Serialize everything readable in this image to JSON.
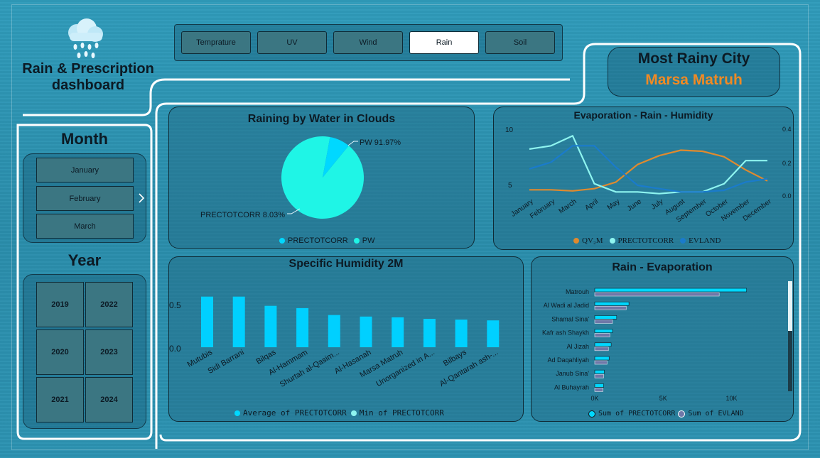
{
  "app": {
    "title_line1": "Rain & Prescription",
    "title_line2": "dashboard"
  },
  "tabs": [
    {
      "label": "Temprature",
      "active": false
    },
    {
      "label": "UV",
      "active": false
    },
    {
      "label": "Wind",
      "active": false
    },
    {
      "label": "Rain",
      "active": true
    },
    {
      "label": "Soil",
      "active": false
    }
  ],
  "kpi": {
    "title": "Most Rainy City",
    "value": "Marsa Matruh"
  },
  "month_slicer": {
    "title": "Month",
    "items": [
      "January",
      "February",
      "March"
    ]
  },
  "year_slicer": {
    "title": "Year",
    "items": [
      "2019",
      "2022",
      "2020",
      "2023",
      "2021",
      "2024"
    ]
  },
  "colors": {
    "accent_orange": "#f08a24",
    "cyan": "#00d8ff",
    "aqua": "#1ff5e6",
    "blue": "#1a7bcc",
    "light_cyan": "#8ff5f0",
    "violet": "#6f78a8"
  },
  "chart_data": [
    {
      "type": "pie",
      "title": "Raining by Water in Clouds",
      "slices": [
        {
          "name": "PW",
          "value": 91.97,
          "label": "PW 91.97%"
        },
        {
          "name": "PRECTOTCORR",
          "value": 8.03,
          "label": "PRECTOTCORR 8.03%"
        }
      ],
      "legend": [
        "PRECTOTCORR",
        "PW"
      ],
      "legend_position": "bottom"
    },
    {
      "type": "line",
      "title": "Evaporation - Rain - Humidity",
      "categories": [
        "January",
        "February",
        "March",
        "April",
        "May",
        "June",
        "July",
        "August",
        "September",
        "October",
        "November",
        "December"
      ],
      "y_left_ticks": [
        "10",
        "5"
      ],
      "y_right_ticks": [
        "0.4",
        "0.2",
        "0.0"
      ],
      "ylim_left": [
        4,
        10
      ],
      "ylim_right": [
        0,
        0.4
      ],
      "series": [
        {
          "name": "QV2M",
          "axis": "left",
          "values": [
            4.5,
            4.5,
            4.4,
            4.6,
            5.2,
            6.8,
            7.6,
            8.1,
            8.0,
            7.5,
            6.3,
            5.3
          ]
        },
        {
          "name": "PRECTOTCORR",
          "axis": "right",
          "values": [
            0.28,
            0.3,
            0.36,
            0.07,
            0.02,
            0.02,
            0.01,
            0.02,
            0.02,
            0.07,
            0.21,
            0.21
          ]
        },
        {
          "name": "EVLAND",
          "axis": "right",
          "values": [
            0.16,
            0.2,
            0.3,
            0.3,
            0.17,
            0.06,
            0.04,
            0.02,
            0.02,
            0.03,
            0.08,
            0.1
          ]
        }
      ],
      "legend": [
        "QV₂M",
        "PRECTOTCORR",
        "EVLAND"
      ],
      "legend_position": "bottom"
    },
    {
      "type": "bar",
      "title": "Specific Humidity 2M",
      "categories": [
        "Mutubis",
        "Sidi Barrani",
        "Bilqas",
        "Al-Hammam",
        "Shurtah al-Qasim...",
        "Al-Hasanah",
        "Marsa Matruh",
        "Unorganized in A...",
        "Bilbays",
        "Al-Qantarah ash-..."
      ],
      "series": [
        {
          "name": "Average of PRECTOTCORR",
          "values": [
            0.66,
            0.66,
            0.54,
            0.51,
            0.42,
            0.4,
            0.39,
            0.37,
            0.36,
            0.35
          ]
        },
        {
          "name": "Min of PRECTOTCORR",
          "values": [
            0,
            0,
            0,
            0,
            0,
            0,
            0,
            0,
            0,
            0
          ]
        }
      ],
      "y_ticks": [
        "0.5",
        "0.0"
      ],
      "ylim": [
        0,
        0.75
      ],
      "legend_position": "bottom"
    },
    {
      "type": "bar",
      "orientation": "horizontal",
      "title": "Rain - Evaporation",
      "categories": [
        "Matrouh",
        "Al Wadi al Jadid",
        "Shamal Sina'",
        "Kafr ash Shaykh",
        "Al Jizah",
        "Ad Daqahliyah",
        "Janub Sina'",
        "Al Buhayrah"
      ],
      "series": [
        {
          "name": "Sum of PRECTOTCORR",
          "values": [
            11100,
            2500,
            1600,
            1300,
            1200,
            1050,
            700,
            650
          ]
        },
        {
          "name": "Sum of EVLAND",
          "values": [
            9100,
            2300,
            1300,
            1100,
            1000,
            900,
            650,
            600
          ]
        }
      ],
      "x_ticks": [
        "0K",
        "5K",
        "10K"
      ],
      "xlim": [
        0,
        12000
      ],
      "legend_position": "bottom"
    }
  ]
}
